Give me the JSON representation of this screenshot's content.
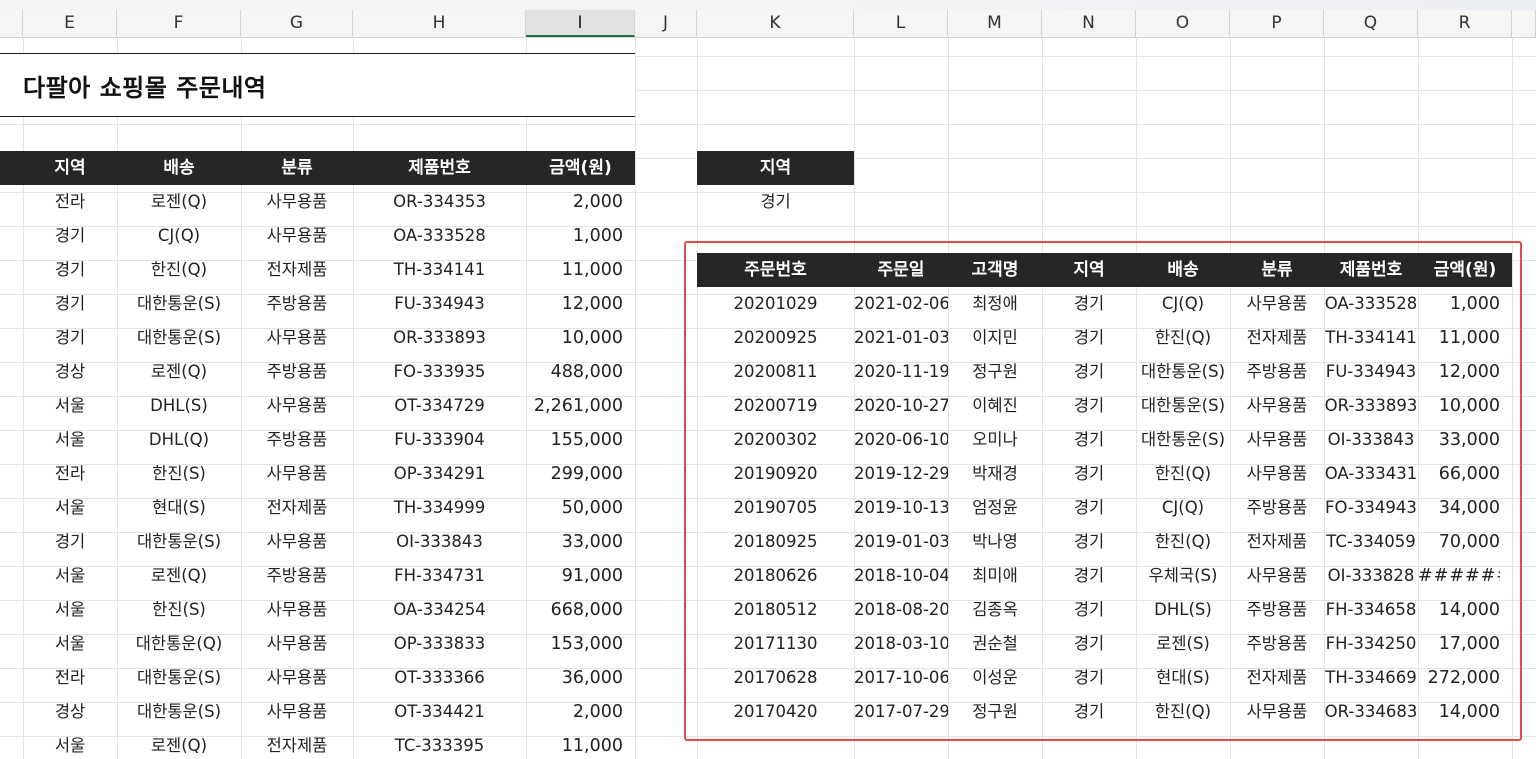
{
  "sheet": {
    "title": "다팔아 쇼핑몰 주문내역",
    "column_letters": [
      "E",
      "F",
      "G",
      "H",
      "I",
      "J",
      "K",
      "L",
      "M",
      "N",
      "O",
      "P",
      "Q",
      "R"
    ],
    "selected_column": "I"
  },
  "main_table": {
    "headers": [
      "지역",
      "배송",
      "분류",
      "제품번호",
      "금액(원)"
    ],
    "rows": [
      [
        "전라",
        "로젠(Q)",
        "사무용품",
        "OR-334353",
        "2,000"
      ],
      [
        "경기",
        "CJ(Q)",
        "사무용품",
        "OA-333528",
        "1,000"
      ],
      [
        "경기",
        "한진(Q)",
        "전자제품",
        "TH-334141",
        "11,000"
      ],
      [
        "경기",
        "대한통운(S)",
        "주방용품",
        "FU-334943",
        "12,000"
      ],
      [
        "경기",
        "대한통운(S)",
        "사무용품",
        "OR-333893",
        "10,000"
      ],
      [
        "경상",
        "로젠(Q)",
        "주방용품",
        "FO-333935",
        "488,000"
      ],
      [
        "서울",
        "DHL(S)",
        "사무용품",
        "OT-334729",
        "2,261,000"
      ],
      [
        "서울",
        "DHL(Q)",
        "주방용품",
        "FU-333904",
        "155,000"
      ],
      [
        "전라",
        "한진(S)",
        "사무용품",
        "OP-334291",
        "299,000"
      ],
      [
        "서울",
        "현대(S)",
        "전자제품",
        "TH-334999",
        "50,000"
      ],
      [
        "경기",
        "대한통운(S)",
        "사무용품",
        "OI-333843",
        "33,000"
      ],
      [
        "서울",
        "로젠(Q)",
        "주방용품",
        "FH-334731",
        "91,000"
      ],
      [
        "서울",
        "한진(S)",
        "사무용품",
        "OA-334254",
        "668,000"
      ],
      [
        "서울",
        "대한통운(Q)",
        "사무용품",
        "OP-333833",
        "153,000"
      ],
      [
        "전라",
        "대한통운(S)",
        "사무용품",
        "OT-333366",
        "36,000"
      ],
      [
        "경상",
        "대한통운(S)",
        "사무용품",
        "OT-334421",
        "2,000"
      ],
      [
        "서울",
        "로젠(Q)",
        "전자제품",
        "TC-333395",
        "11,000"
      ]
    ]
  },
  "criteria": {
    "header": "지역",
    "value": "경기"
  },
  "result_table": {
    "headers": [
      "주문번호",
      "주문일",
      "고객명",
      "지역",
      "배송",
      "분류",
      "제품번호",
      "금액(원)"
    ],
    "rows": [
      [
        "20201029",
        "2021-02-06",
        "최정애",
        "경기",
        "CJ(Q)",
        "사무용품",
        "OA-333528",
        "1,000"
      ],
      [
        "20200925",
        "2021-01-03",
        "이지민",
        "경기",
        "한진(Q)",
        "전자제품",
        "TH-334141",
        "11,000"
      ],
      [
        "20200811",
        "2020-11-19",
        "정구원",
        "경기",
        "대한통운(S)",
        "주방용품",
        "FU-334943",
        "12,000"
      ],
      [
        "20200719",
        "2020-10-27",
        "이혜진",
        "경기",
        "대한통운(S)",
        "사무용품",
        "OR-333893",
        "10,000"
      ],
      [
        "20200302",
        "2020-06-10",
        "오미나",
        "경기",
        "대한통운(S)",
        "사무용품",
        "OI-333843",
        "33,000"
      ],
      [
        "20190920",
        "2019-12-29",
        "박재경",
        "경기",
        "한진(Q)",
        "사무용품",
        "OA-333431",
        "66,000"
      ],
      [
        "20190705",
        "2019-10-13",
        "엄정윤",
        "경기",
        "CJ(Q)",
        "주방용품",
        "FO-334943",
        "34,000"
      ],
      [
        "20180925",
        "2019-01-03",
        "박나영",
        "경기",
        "한진(Q)",
        "전자제품",
        "TC-334059",
        "70,000"
      ],
      [
        "20180626",
        "2018-10-04",
        "최미애",
        "경기",
        "우체국(S)",
        "사무용품",
        "OI-333828",
        "######"
      ],
      [
        "20180512",
        "2018-08-20",
        "김종옥",
        "경기",
        "DHL(S)",
        "주방용품",
        "FH-334658",
        "14,000"
      ],
      [
        "20171130",
        "2018-03-10",
        "권순철",
        "경기",
        "로젠(S)",
        "주방용품",
        "FH-334250",
        "17,000"
      ],
      [
        "20170628",
        "2017-10-06",
        "이성운",
        "경기",
        "현대(S)",
        "전자제품",
        "TH-334669",
        "272,000"
      ],
      [
        "20170420",
        "2017-07-29",
        "정구원",
        "경기",
        "한진(Q)",
        "사무용품",
        "OR-334683",
        "14,000"
      ]
    ]
  },
  "colors": {
    "header_bg": "#262626",
    "header_text": "#ffffff",
    "highlight_border": "#e34c4c",
    "selected_column_accent": "#217346"
  }
}
